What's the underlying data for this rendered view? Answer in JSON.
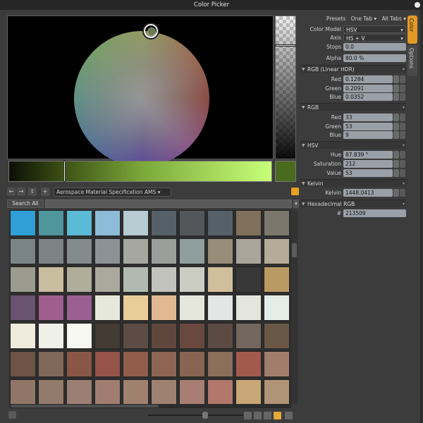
{
  "window": {
    "title": "Color Picker"
  },
  "picker": {
    "value_bar_colors": [
      "#0c0f06",
      "#c8ff78"
    ],
    "current_color": "#4a6a1e"
  },
  "presets_bar": {
    "preset_name": "Aerospace Material Specification AMS"
  },
  "search": {
    "label": "Search All"
  },
  "swatches": [
    "#2f9fd6",
    "#4e959c",
    "#5bbad6",
    "#8cbcd7",
    "#b6cbd2",
    "#566069",
    "#545759",
    "#566068",
    "#7f705c",
    "#7c776c",
    "#7a8487",
    "#7e8386",
    "#838b8c",
    "#8c9295",
    "#a6a8a0",
    "#9a9f9c",
    "#8e9e9d",
    "#958c7a",
    "#a9a59a",
    "#b4ab98",
    "#9b9c8d",
    "#c8bd9e",
    "#b0ae9b",
    "#a9a99c",
    "#b1bab1",
    "#c2c3bc",
    "#cbccc4",
    "#d1bf9b",
    "#383838",
    "#b99a63",
    "#6a5272",
    "#9f5e8d",
    "#9c5f91",
    "#e6e8d9",
    "#e8cd98",
    "#e1b891",
    "#e6e7dc",
    "#e3e6e4",
    "#e4e5dc",
    "#e5eee6",
    "#efeadb",
    "#eff1e8",
    "#f6f7f1",
    "#433b34",
    "#5c4c43",
    "#60473e",
    "#69493f",
    "#5c4b43",
    "#74675d",
    "#6a5847",
    "#6d5445",
    "#806958",
    "#8a5747",
    "#955349",
    "#915e4c",
    "#8e6552",
    "#886553",
    "#8c6f58",
    "#a45a4b",
    "#a17e6b",
    "#8f7666",
    "#927b6c",
    "#9b7f74",
    "#a07d70",
    "#a0806f",
    "#9e8170",
    "#a77e71",
    "#b0776a",
    "#c9a675",
    "#b09475"
  ],
  "top_links": {
    "presets": "Presets",
    "one_tab": "One Tab ▾",
    "all_tabs": "All Tabs ▾"
  },
  "settings": {
    "color_model_label": "Color Model",
    "color_model": "HSV",
    "axis_label": "Axis",
    "axis": "HS + V",
    "stops_label": "Stops",
    "stops": "0.0",
    "alpha_label": "Alpha",
    "alpha": "80.0 %"
  },
  "rgb_linear": {
    "title": "RGB (Linear HDR)",
    "red_label": "Red",
    "red": "0.1284",
    "green_label": "Green",
    "green": "0.2091",
    "blue_label": "Blue",
    "blue": "0.0352"
  },
  "rgb": {
    "title": "RGB",
    "red_label": "Red",
    "red": "33",
    "green_label": "Green",
    "green": "53",
    "blue_label": "Blue",
    "blue": "9"
  },
  "hsv": {
    "title": "HSV",
    "hue_label": "Hue",
    "hue": "87.839 °",
    "sat_label": "Saturation",
    "sat": "212",
    "val_label": "Value",
    "val": "53"
  },
  "kelvin": {
    "title": "Kelvin",
    "label": "Kelvin",
    "value": "1448.0413"
  },
  "hex": {
    "title": "Hexadecimal RGB",
    "label": "#",
    "value": "213509"
  },
  "side_tabs": {
    "color": "Color",
    "options": "Options"
  }
}
